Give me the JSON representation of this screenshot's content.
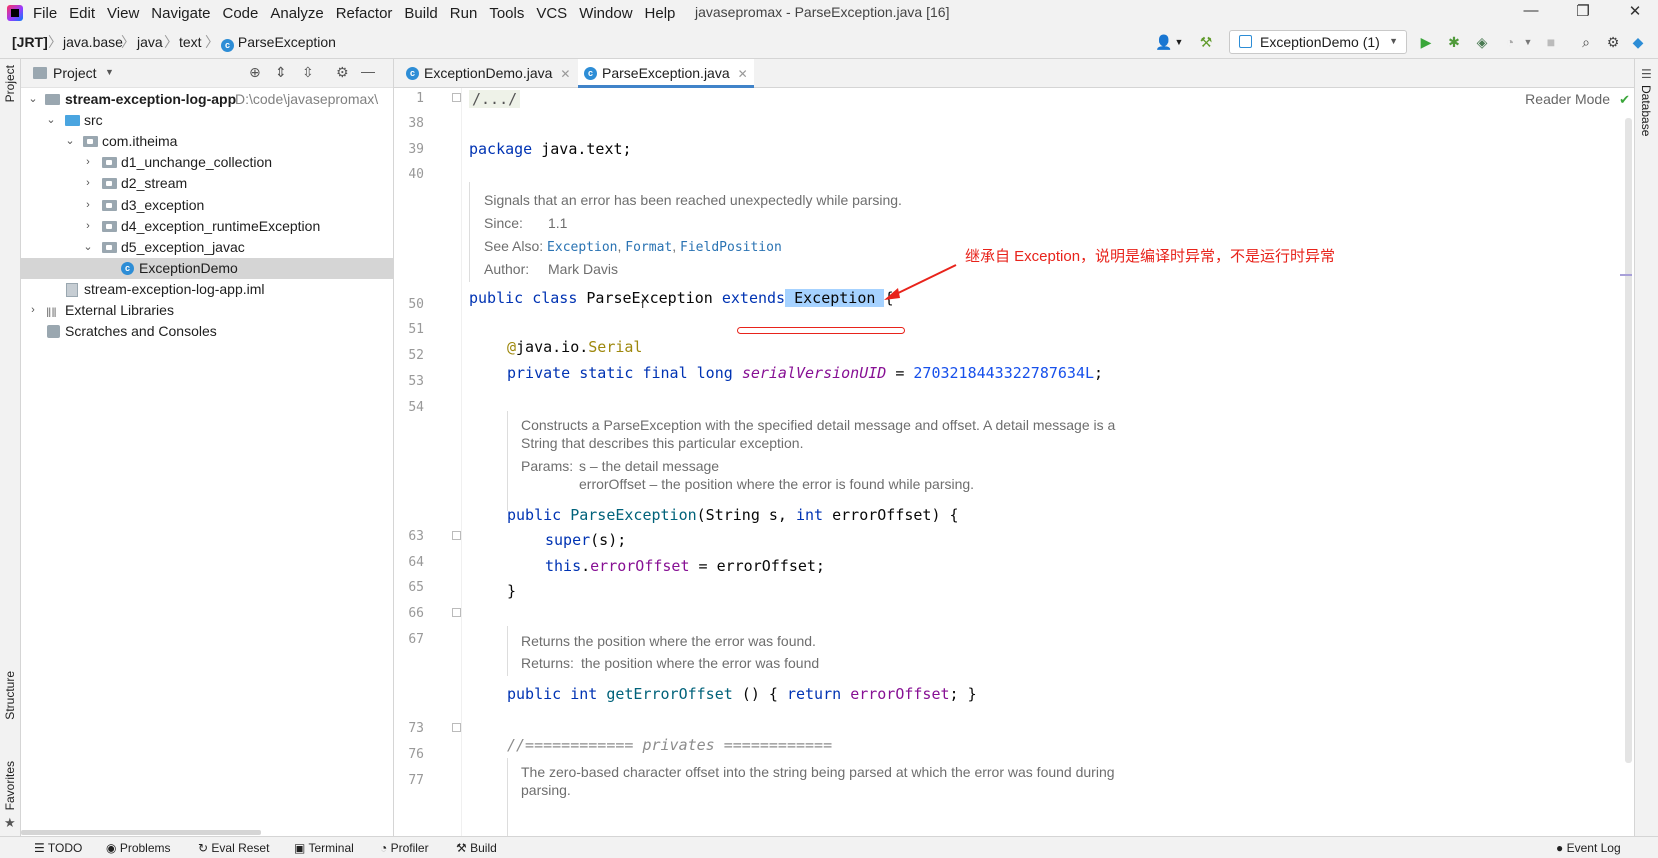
{
  "menu": {
    "items": [
      "File",
      "Edit",
      "View",
      "Navigate",
      "Code",
      "Analyze",
      "Refactor",
      "Build",
      "Run",
      "Tools",
      "VCS",
      "Window",
      "Help"
    ],
    "window_title": "javasepromax - ParseException.java [16]"
  },
  "breadcrumb": [
    "[JRT]",
    "java.base",
    "java",
    "text",
    "ParseException"
  ],
  "run_config": "ExceptionDemo (1)",
  "project_panel": {
    "title": "Project",
    "tree": [
      {
        "label": "stream-exception-log-app",
        "path": "D:\\code\\javasepromax\\",
        "bold": true
      },
      {
        "label": "src"
      },
      {
        "label": "com.itheima"
      },
      {
        "label": "d1_unchange_collection"
      },
      {
        "label": "d2_stream"
      },
      {
        "label": "d3_exception"
      },
      {
        "label": "d4_exception_runtimeException"
      },
      {
        "label": "d5_exception_javac"
      },
      {
        "label": "ExceptionDemo"
      },
      {
        "label": "stream-exception-log-app.iml"
      },
      {
        "label": "External Libraries"
      },
      {
        "label": "Scratches and Consoles"
      }
    ]
  },
  "tabs": [
    {
      "label": "ExceptionDemo.java",
      "close": "✕"
    },
    {
      "label": "ParseException.java",
      "close": "✕"
    }
  ],
  "editor": {
    "reader_mode": "Reader Mode",
    "line_numbers": [
      "1",
      "38",
      "39",
      "40",
      "50",
      "51",
      "52",
      "53",
      "54",
      "63",
      "64",
      "65",
      "66",
      "67",
      "73",
      "76",
      "77"
    ],
    "fold_comment": "/.../",
    "package_kw": "package",
    "package_name": "java.text;",
    "doc1": {
      "summary": "Signals that an error has been reached unexpectedly while parsing.",
      "since_label": "Since:",
      "since_value": "1.1",
      "see_label": "See Also:",
      "see_links": [
        "Exception",
        "Format",
        "FieldPosition"
      ],
      "author_label": "Author:",
      "author_value": "Mark Davis"
    },
    "class_decl": {
      "public": "public",
      "class": "class",
      "name": "ParseException",
      "extends": "extends",
      "parent": "Exception",
      "brace": "{"
    },
    "serial_at": "@",
    "serial_pkg": "java.io.",
    "serial_name": "Serial",
    "field_decl": {
      "mods": "private static final long",
      "name": "serialVersionUID",
      "eq": " = ",
      "value": "2703218443322787634L",
      "semi": ";"
    },
    "doc2": {
      "line1": "Constructs a ParseException with the specified detail message and offset. A detail message is a",
      "line2": "String that describes this particular exception.",
      "params_label": "Params:",
      "param1": "s – the detail message",
      "param2": "errorOffset – the position where the error is found while parsing."
    },
    "ctor": {
      "public": "public",
      "name": "ParseException",
      "args_open": "(String s, ",
      "int": "int",
      "args_close": " errorOffset) {"
    },
    "super_line": {
      "kw": "super",
      "rest": "(s);"
    },
    "this_line": {
      "kw": "this",
      "dot": ".",
      "field": "errorOffset",
      "rest": " = errorOffset;"
    },
    "close_brace": "}",
    "doc3": {
      "line1": "Returns the position where the error was found.",
      "returns_label": "Returns:",
      "returns_value": "the position where the error was found"
    },
    "getter": {
      "public": "public",
      "int": "int",
      "name": "getErrorOffset",
      "open": " () { ",
      "return": "return",
      "field": "errorOffset",
      "close": "; }"
    },
    "privates_comment": "//============ privates ============",
    "doc4": {
      "line1": "The zero-based character offset into the string being parsed at which the error was found during",
      "line2": "parsing."
    }
  },
  "annotation_note": "继承自 Exception，说明是编译时异常，不是运行时异常",
  "left_strip": {
    "project": "Project",
    "structure": "Structure",
    "favorites": "Favorites"
  },
  "right_strip": {
    "database": "Database"
  },
  "bottom_bar": [
    "TODO",
    "Problems",
    "Eval Reset",
    "Terminal",
    "Profiler",
    "Build",
    "Event Log"
  ],
  "colors": {
    "accent": "#4083c9",
    "annotation_red": "#e8231b",
    "selection": "#a6d2ff"
  }
}
